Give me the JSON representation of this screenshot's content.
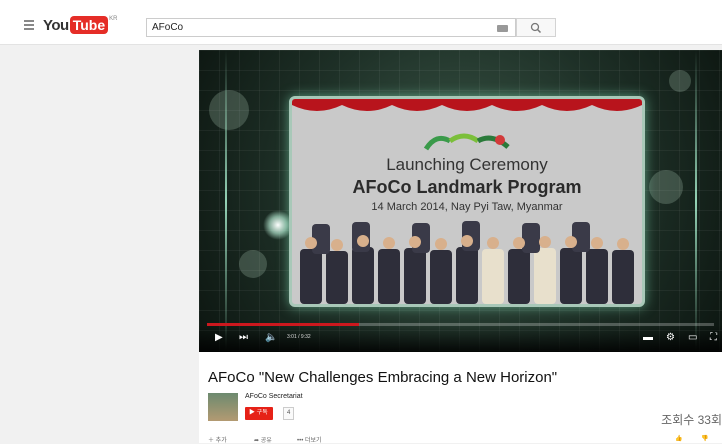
{
  "header": {
    "logo_you": "You",
    "logo_tube": "Tube",
    "logo_region": "KR",
    "search_value": "AFoCo"
  },
  "video": {
    "slide_title1": "Launching Ceremony",
    "slide_title2": "AFoCo Landmark Program",
    "slide_subtitle": "14 March 2014, Nay Pyi Taw, Myanmar",
    "time": "3:01 / 9:32",
    "progress": 0.3
  },
  "info": {
    "title": "AFoCo \"New Challenges Embracing a New Horizon\"",
    "channel": "AFoCo Secretariat",
    "subscribe_label": "구독",
    "subscriber_count": "4",
    "views": "조회수 33회",
    "add_label": "추가",
    "share_label": "공유",
    "more_label": "더보기"
  },
  "colors": {
    "brand_red": "#e52d27",
    "subscribe_red": "#e62117"
  }
}
